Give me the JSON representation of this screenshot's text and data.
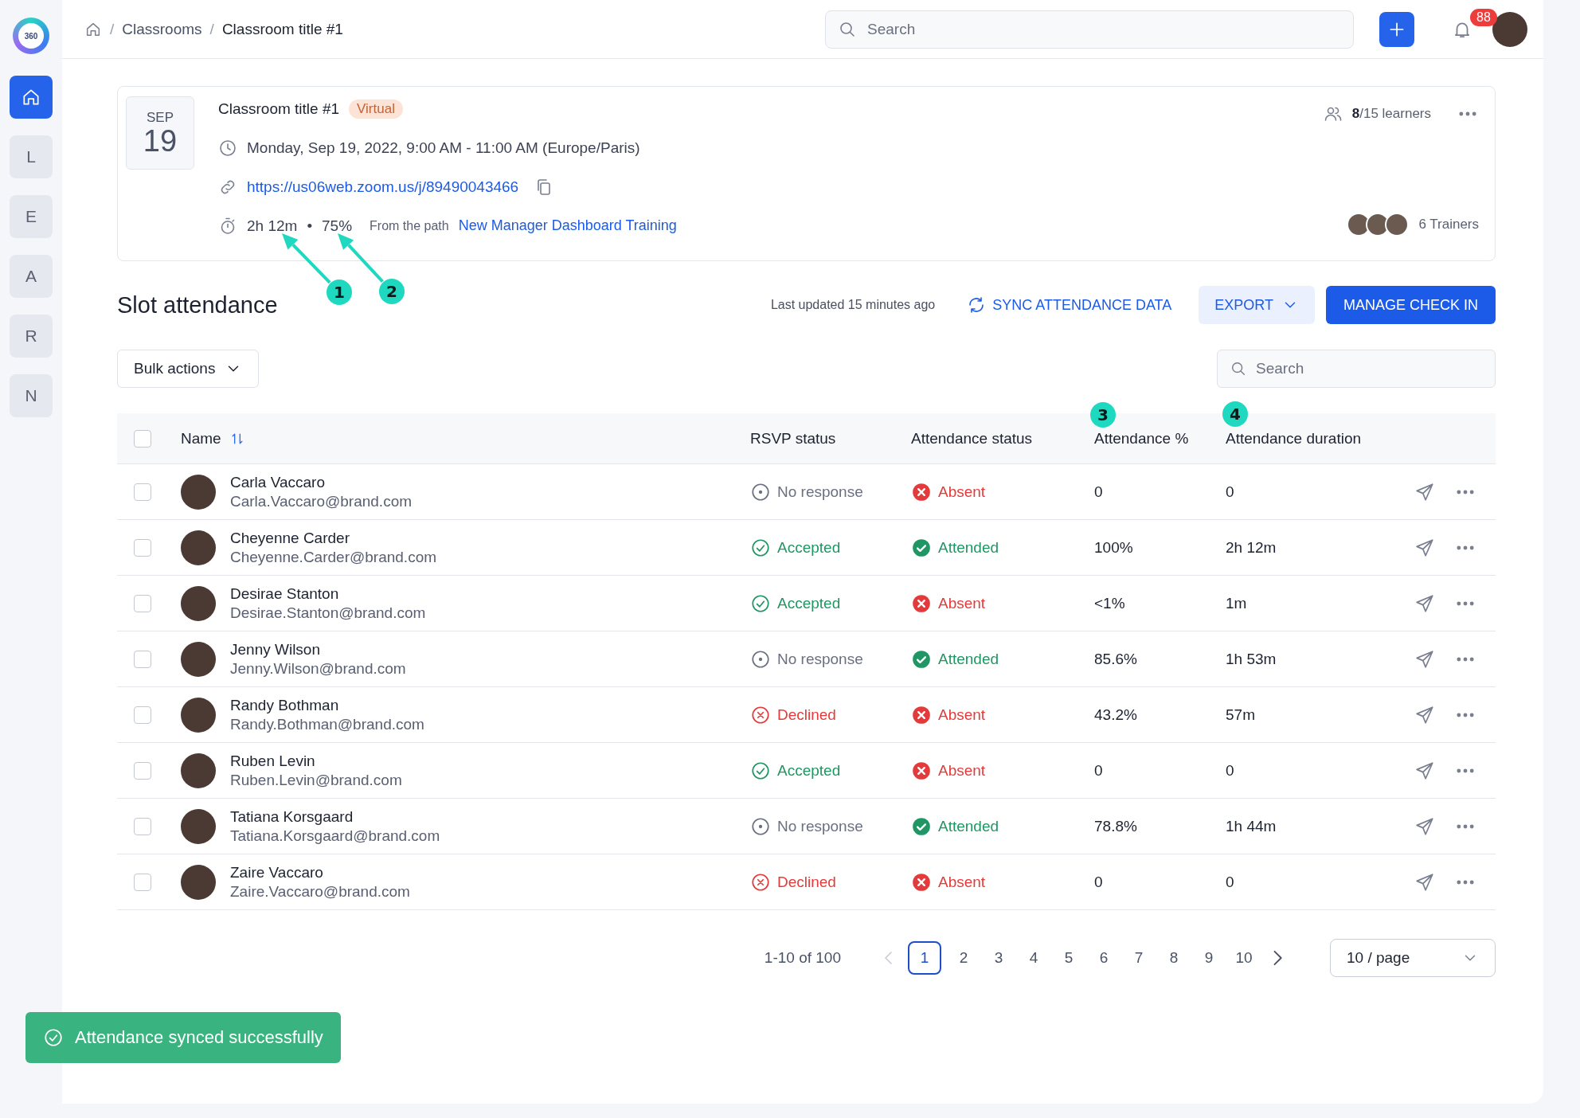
{
  "sidebar": {
    "logo": "360",
    "items": [
      {
        "kind": "home",
        "selected": true
      },
      {
        "kind": "letter",
        "label": "L",
        "selected": false
      },
      {
        "kind": "letter",
        "label": "E",
        "selected": false
      },
      {
        "kind": "letter",
        "label": "A",
        "selected": false
      },
      {
        "kind": "letter",
        "label": "R",
        "selected": false
      },
      {
        "kind": "letter",
        "label": "N",
        "selected": false
      }
    ]
  },
  "header": {
    "breadcrumb": [
      {
        "label": "/"
      },
      {
        "label": "Classrooms",
        "link": true
      },
      {
        "label": "/"
      },
      {
        "label": "Classroom title #1",
        "link": false
      }
    ],
    "search": {
      "placeholder": "Search"
    },
    "notifications": "88"
  },
  "classroom": {
    "month": "SEP",
    "day": "19",
    "title": "Classroom title #1",
    "tag": "Virtual",
    "learners": "**8**/15 learners",
    "schedule": "Monday, Sep 19, 2022, 9:00 AM - 11:00 AM (Europe/Paris)",
    "url": "https://us06web.zoom.us/j/89490043466",
    "duration": "2h 12m",
    "separator": "•",
    "percent": "75%",
    "path_prefix": "From the path",
    "path_link": "New Manager Dashboard Training",
    "trainers": "6 Trainers"
  },
  "section": {
    "title": "Slot attendance",
    "last_updated": "Last updated 15 minutes ago",
    "sync": "SYNC ATTENDANCE DATA",
    "export": "EXPORT",
    "manage": "MANAGE CHECK IN",
    "bulk": "Bulk actions",
    "search": {
      "placeholder": "Search"
    }
  },
  "table": {
    "all_checked": false,
    "columns": [
      "Name",
      "RSVP status",
      "Attendance status",
      "Attendance %",
      "Attendance duration"
    ],
    "rows": [
      {
        "name": "Carla Vaccaro",
        "email": "Carla.Vaccaro@brand.com",
        "rsvp": {
          "kind": "none",
          "label": "No response"
        },
        "attendance": {
          "kind": "absent",
          "label": "Absent"
        },
        "percent": "0",
        "duration": "0",
        "checked": false
      },
      {
        "name": "Cheyenne Carder",
        "email": "Cheyenne.Carder@brand.com",
        "rsvp": {
          "kind": "accepted",
          "label": "Accepted"
        },
        "attendance": {
          "kind": "attended",
          "label": "Attended"
        },
        "percent": "100%",
        "duration": "2h 12m",
        "checked": false
      },
      {
        "name": "Desirae Stanton",
        "email": "Desirae.Stanton@brand.com",
        "rsvp": {
          "kind": "accepted",
          "label": "Accepted"
        },
        "attendance": {
          "kind": "absent",
          "label": "Absent"
        },
        "percent": "<1%",
        "duration": "1m",
        "checked": false
      },
      {
        "name": "Jenny Wilson",
        "email": "Jenny.Wilson@brand.com",
        "rsvp": {
          "kind": "none",
          "label": "No response"
        },
        "attendance": {
          "kind": "attended",
          "label": "Attended"
        },
        "percent": "85.6%",
        "duration": "1h 53m",
        "checked": false
      },
      {
        "name": "Randy Bothman",
        "email": "Randy.Bothman@brand.com",
        "rsvp": {
          "kind": "declined",
          "label": "Declined"
        },
        "attendance": {
          "kind": "absent",
          "label": "Absent"
        },
        "percent": "43.2%",
        "duration": "57m",
        "checked": false
      },
      {
        "name": "Ruben Levin",
        "email": "Ruben.Levin@brand.com",
        "rsvp": {
          "kind": "accepted",
          "label": "Accepted"
        },
        "attendance": {
          "kind": "absent",
          "label": "Absent"
        },
        "percent": "0",
        "duration": "0",
        "checked": false
      },
      {
        "name": "Tatiana Korsgaard",
        "email": "Tatiana.Korsgaard@brand.com",
        "rsvp": {
          "kind": "none",
          "label": "No response"
        },
        "attendance": {
          "kind": "attended",
          "label": "Attended"
        },
        "percent": "78.8%",
        "duration": "1h 44m",
        "checked": false
      },
      {
        "name": "Zaire Vaccaro",
        "email": "Zaire.Vaccaro@brand.com",
        "rsvp": {
          "kind": "declined",
          "label": "Declined"
        },
        "attendance": {
          "kind": "absent",
          "label": "Absent"
        },
        "percent": "0",
        "duration": "0",
        "checked": false
      }
    ]
  },
  "pagination": {
    "summary": "1-10 of 100",
    "prev_disabled": true,
    "pages": [
      {
        "label": "1",
        "selected": true
      },
      {
        "label": "2",
        "selected": false
      },
      {
        "label": "3",
        "selected": false
      },
      {
        "label": "4",
        "selected": false
      },
      {
        "label": "5",
        "selected": false
      },
      {
        "label": "6",
        "selected": false
      },
      {
        "label": "7",
        "selected": false
      },
      {
        "label": "8",
        "selected": false
      },
      {
        "label": "9",
        "selected": false
      },
      {
        "label": "10",
        "selected": false
      }
    ],
    "page_size": "10 / page"
  },
  "toast": {
    "kind": "success",
    "message": "Attendance synced successfully"
  },
  "annotations": [
    {
      "label": "1",
      "kind": "arrow"
    },
    {
      "label": "2",
      "kind": "arrow"
    },
    {
      "label": "3",
      "kind": "marker"
    },
    {
      "label": "4",
      "kind": "marker"
    }
  ]
}
